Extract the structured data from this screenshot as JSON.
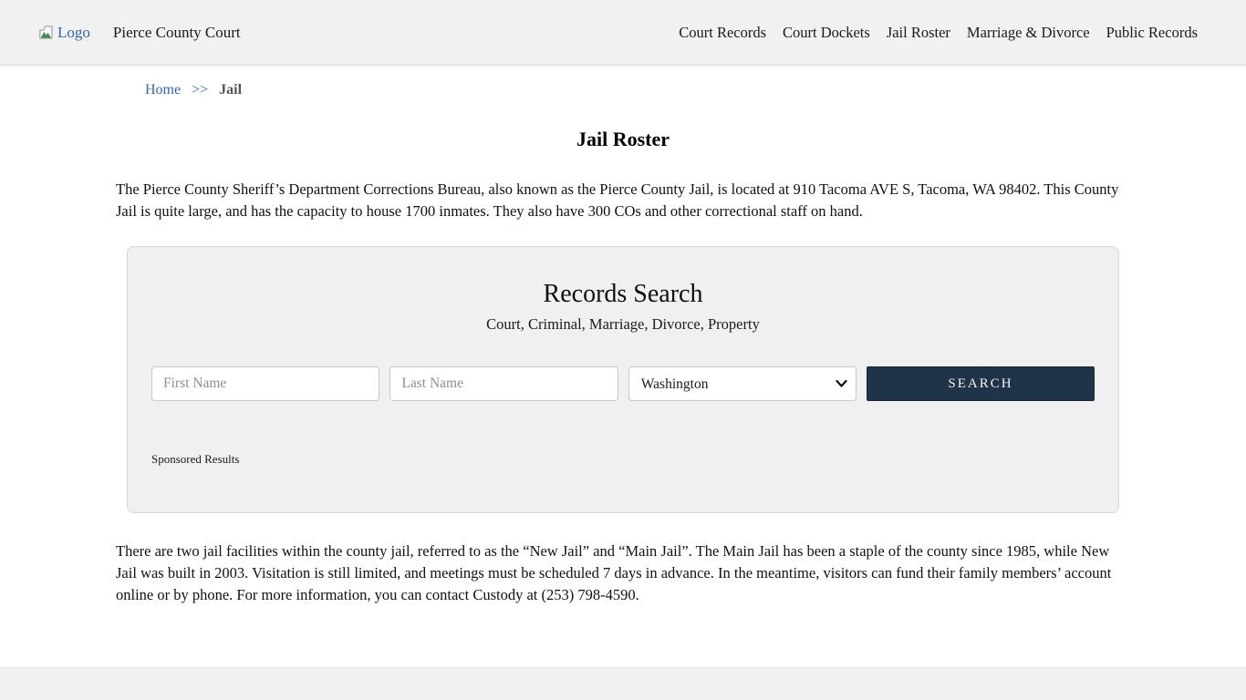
{
  "header": {
    "logo_alt": "Logo",
    "site_title": "Pierce County Court",
    "nav": [
      {
        "label": "Court Records"
      },
      {
        "label": "Court Dockets"
      },
      {
        "label": "Jail Roster"
      },
      {
        "label": "Marriage & Divorce"
      },
      {
        "label": "Public Records"
      }
    ]
  },
  "breadcrumb": {
    "home_label": "Home",
    "separator": ">>",
    "current": "Jail"
  },
  "page": {
    "title": "Jail Roster",
    "intro": "The Pierce County Sheriff’s Department Corrections Bureau, also known as the Pierce County Jail, is located at 910 Tacoma AVE S, Tacoma, WA 98402. This County Jail is quite large, and has the capacity to house 1700 inmates. They also have 300 COs and other correctional staff on hand.",
    "outro": "There are two jail facilities within the county jail, referred to as the “New Jail” and “Main Jail”. The Main Jail has been a staple of the county since 1985, while New Jail was built in 2003. Visitation is still limited, and meetings must be scheduled 7 days in advance. In the meantime, visitors can fund their family members’ account online or by phone. For more information, you can contact Custody at (253) 798-4590."
  },
  "search": {
    "title": "Records Search",
    "subtitle": "Court, Criminal, Marriage, Divorce, Property",
    "first_name_placeholder": "First Name",
    "last_name_placeholder": "Last Name",
    "state_selected": "Washington",
    "search_label": "SEARCH",
    "sponsored_label": "Sponsored Results"
  },
  "colors": {
    "accent_navy": "#203449",
    "link_blue": "#3366aa",
    "header_bg": "#f1f1f1",
    "panel_bg": "#f0f0f0"
  }
}
